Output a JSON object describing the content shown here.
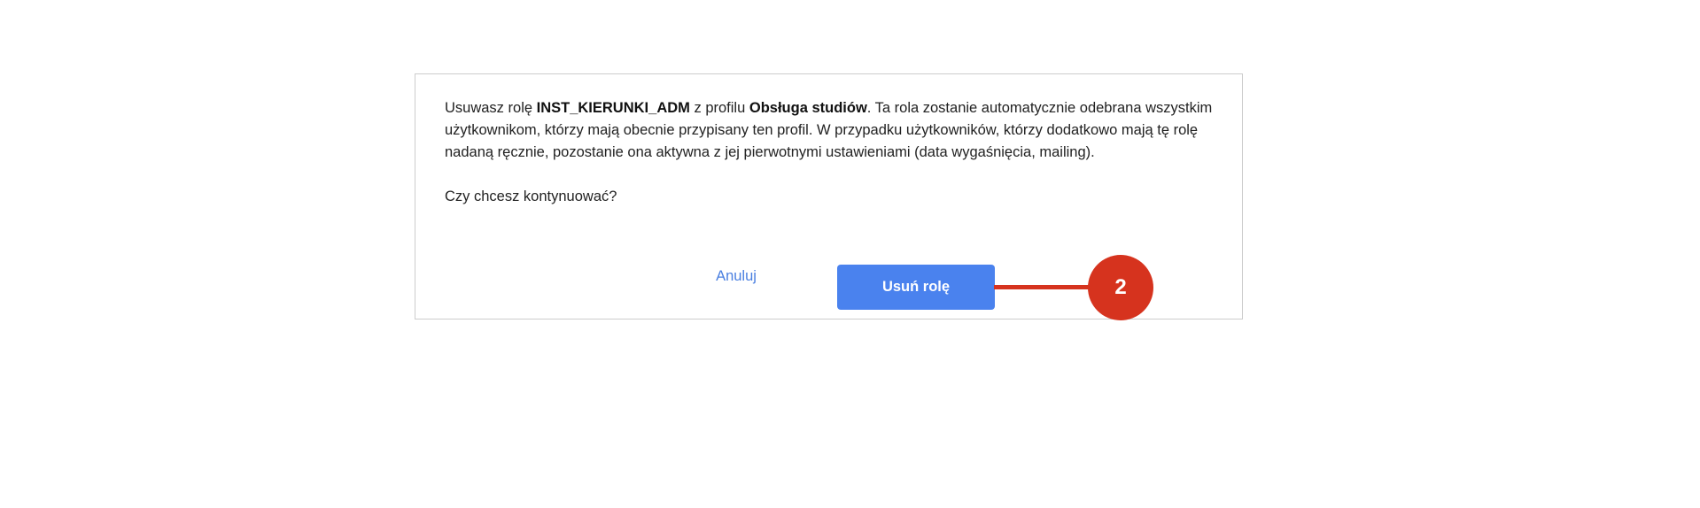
{
  "dialog": {
    "message": {
      "prefix": "Usuwasz rolę ",
      "role_name": "INST_KIERUNKI_ADM",
      "middle": " z profilu ",
      "profile_name": "Obsługa studiów",
      "suffix": ". Ta rola zostanie automatycznie odebrana wszystkim użytkownikom, którzy mają obecnie przypisany ten profil. W przypadku użytkowników, którzy dodatkowo mają tę rolę nadaną ręcznie, pozostanie ona aktywna z jej pierwotnymi ustawieniami (data wygaśnięcia, mailing)."
    },
    "question": "Czy chcesz kontynuować?",
    "cancel_label": "Anuluj",
    "confirm_label": "Usuń rolę"
  },
  "annotation": {
    "step_number": "2",
    "color": "#d6331e"
  },
  "colors": {
    "primary_button": "#4a82ee",
    "link": "#4a7fe0"
  }
}
